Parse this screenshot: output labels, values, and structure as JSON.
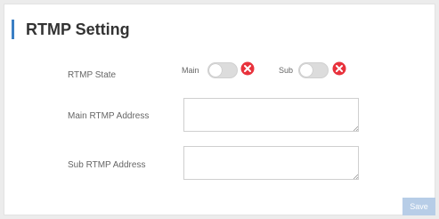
{
  "page": {
    "title": "RTMP Setting",
    "accent_color": "#3b7fc4"
  },
  "rtmp_state": {
    "label": "RTMP State",
    "main": {
      "label": "Main",
      "enabled": false,
      "status_icon": "close-icon",
      "status_color": "#e8323c"
    },
    "sub": {
      "label": "Sub",
      "enabled": false,
      "status_icon": "close-icon",
      "status_color": "#e8323c"
    }
  },
  "main_address": {
    "label": "Main RTMP Address",
    "value": ""
  },
  "sub_address": {
    "label": "Sub RTMP Address",
    "value": ""
  },
  "actions": {
    "save_label": "Save",
    "save_color": "#b7cde7"
  }
}
